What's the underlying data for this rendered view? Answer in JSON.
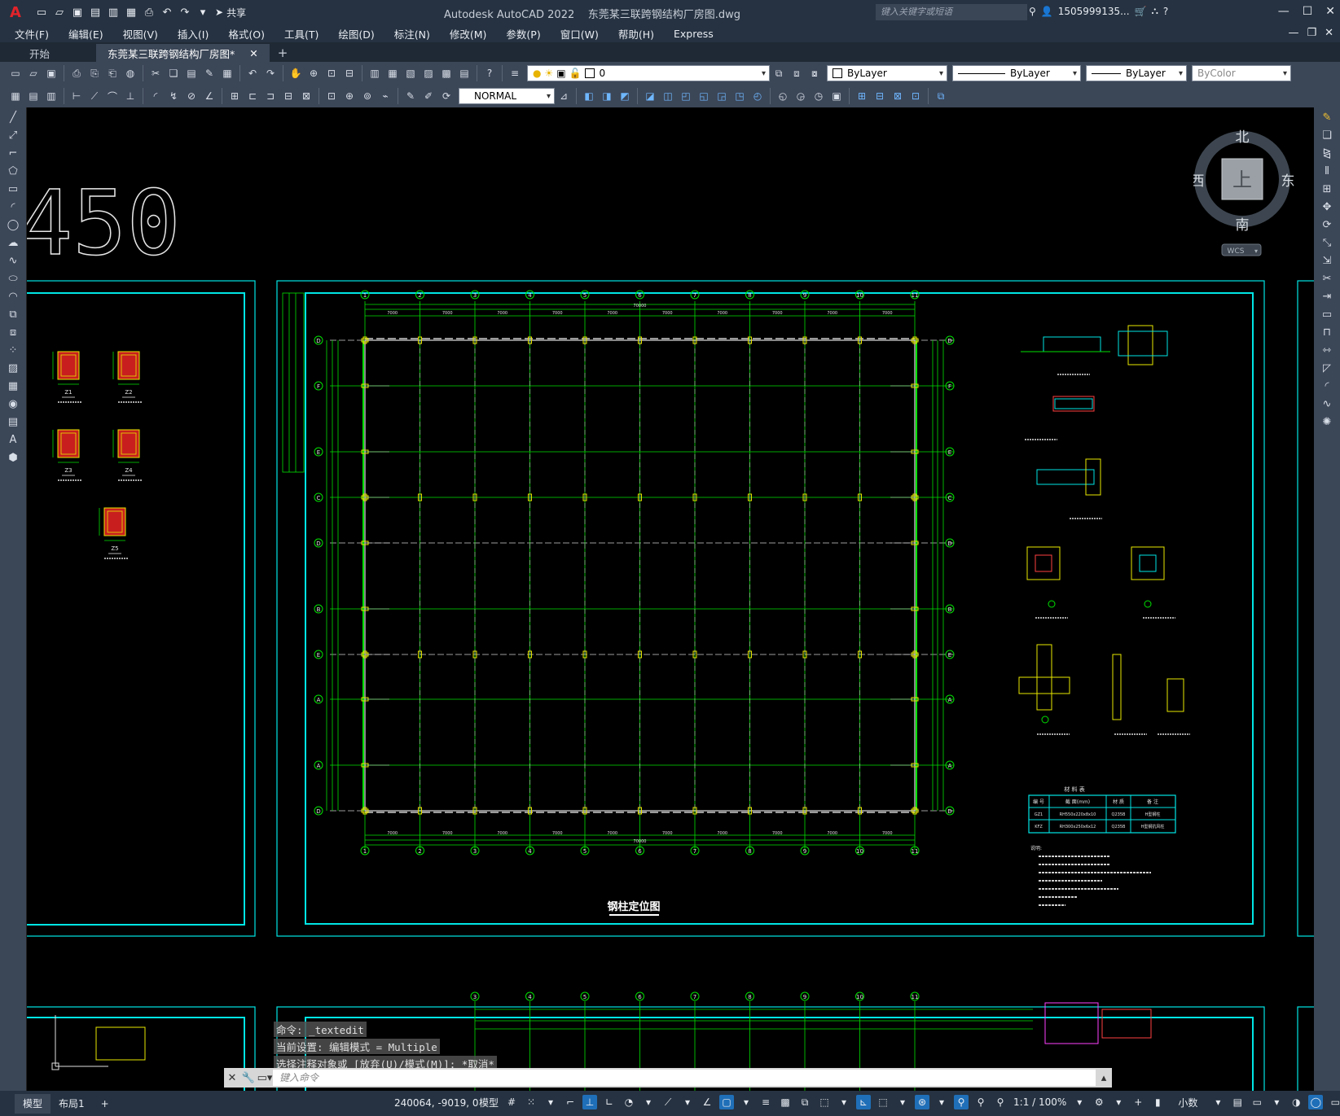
{
  "titlebar": {
    "app_name": "Autodesk AutoCAD 2022",
    "file_name": "东莞某三联跨钢结构厂房图.dwg",
    "share_label": "共享",
    "search_placeholder": "键入关键字或短语",
    "user_name": "1505999135...",
    "accent_color": "#e2232a"
  },
  "menu": {
    "items": [
      "文件(F)",
      "编辑(E)",
      "视图(V)",
      "插入(I)",
      "格式(O)",
      "工具(T)",
      "绘图(D)",
      "标注(N)",
      "修改(M)",
      "参数(P)",
      "窗口(W)",
      "帮助(H)",
      "Express"
    ]
  },
  "tabs": {
    "start_label": "开始",
    "doc_label": "东莞某三联跨钢结构厂房图*"
  },
  "toolbar": {
    "layer_value": "0",
    "color_value": "ByLayer",
    "linetype_value": "ByLayer",
    "lineweight_value": "ByLayer",
    "plotstyle_value": "ByColor",
    "textstyle_value": "NORMAL"
  },
  "drawing": {
    "big_number": "450",
    "main_title": "钢柱定位图",
    "column_numbers": [
      "1",
      "2",
      "3",
      "4",
      "5",
      "6",
      "7",
      "8",
      "9",
      "10",
      "11"
    ],
    "row_letters": [
      "D",
      "F",
      "E",
      "C",
      "D",
      "B",
      "E",
      "A",
      "A"
    ],
    "bay_dims": [
      "7000",
      "7000",
      "7000",
      "7000",
      "7000",
      "7000",
      "7000",
      "7000",
      "7000",
      "7000"
    ],
    "total_dim": "70000",
    "detail_labels": [
      "Z1",
      "Z2",
      "Z3",
      "Z4",
      "Z5"
    ],
    "material_table": {
      "title": "材 料 表",
      "headers": [
        "编 号",
        "截 面(mm)",
        "材 质",
        "备 注"
      ],
      "rows": [
        [
          "GZ1",
          "RH550x220x8x10",
          "Q235B",
          "H型钢柱"
        ],
        [
          "KFZ",
          "RH300x250x6x12",
          "Q235B",
          "H型钢抗风柱"
        ]
      ]
    },
    "notes_title": "说明:"
  },
  "viewcube": {
    "north": "北",
    "south": "南",
    "east": "东",
    "west": "西",
    "top": "上",
    "wcs": "WCS"
  },
  "command": {
    "history": [
      "命令: _textedit",
      "当前设置: 编辑模式 = Multiple",
      "选择注释对象或 [放弃(U)/模式(M)]: *取消*"
    ],
    "placeholder": "键入命令"
  },
  "status": {
    "model_tab": "模型",
    "layout_tab": "布局1",
    "coords": "240064, -9019, 0",
    "model_label": "模型",
    "scale": "1:1 / 100%",
    "units": "小数"
  }
}
